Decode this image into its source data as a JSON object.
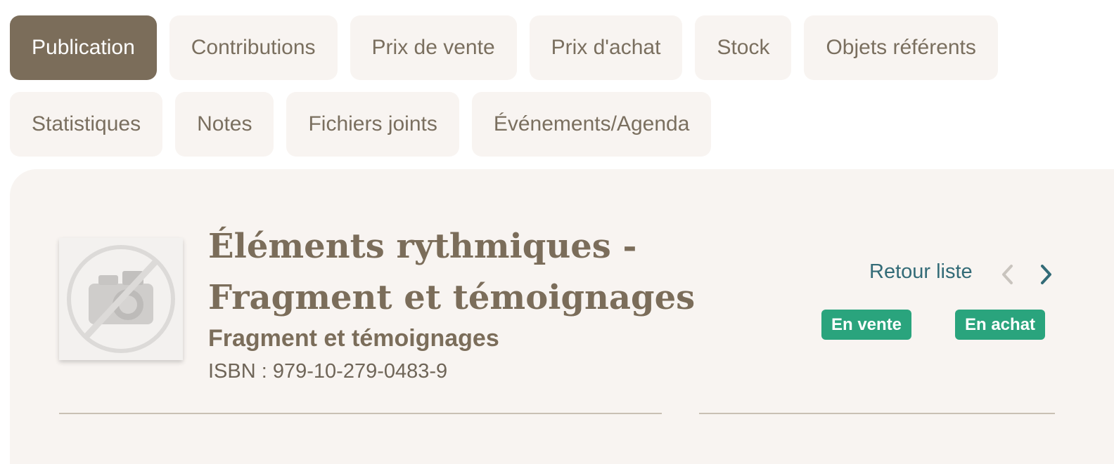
{
  "tabs": {
    "row1": [
      "Publication",
      "Contributions",
      "Prix de vente",
      "Prix d'achat",
      "Stock",
      "Objets référents"
    ],
    "row2": [
      "Statistiques",
      "Notes",
      "Fichiers joints",
      "Événements/Agenda"
    ],
    "active": "Publication"
  },
  "book": {
    "cover_icon": "no-photo-camera-icon",
    "title": "Éléments rythmiques - Fragment et témoignages",
    "subtitle": "Fragment et témoignages",
    "isbn": "ISBN : 979-10-279-0483-9"
  },
  "navigation": {
    "back_label": "Retour liste",
    "prev_icon": "chevron-left-icon",
    "next_icon": "chevron-right-icon"
  },
  "badges": {
    "sale": "En vente",
    "purchase": "En achat"
  },
  "colors": {
    "accent": "#7b6d5a",
    "tab_background": "#f8f4f1",
    "link": "#336b77",
    "badge": "#2aa47d"
  }
}
